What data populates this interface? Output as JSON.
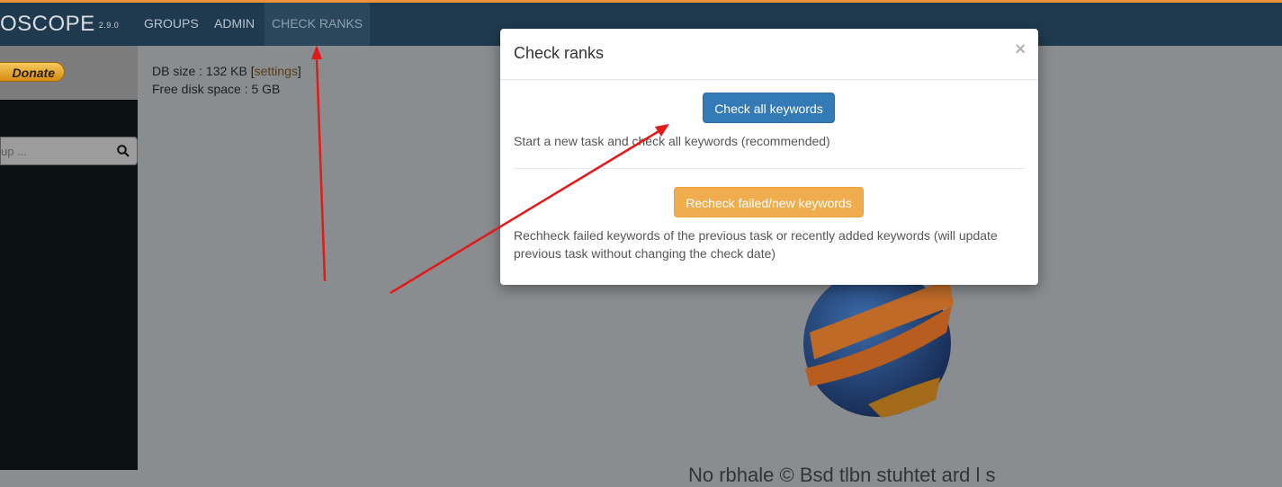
{
  "navbar": {
    "brand": "OSCOPE",
    "version": "2.9.0",
    "items": [
      "GROUPS",
      "ADMIN",
      "CHECK RANKS"
    ]
  },
  "sidebar": {
    "donate_label": "Donate",
    "search_placeholder": "up ..."
  },
  "info": {
    "db_size": "DB size : 132 KB [",
    "settings": "settings",
    "db_close": "]",
    "free_disk": "Free disk space : 5 GB"
  },
  "background": {
    "bottom_text": "No rbhale  © Bsd tlbn stuhtet ard l s"
  },
  "modal": {
    "title": "Check ranks",
    "close_symbol": "×",
    "check_all_label": "Check all keywords",
    "check_all_desc": "Start a new task and check all keywords (recommended)",
    "recheck_label": "Recheck failed/new keywords",
    "recheck_desc": "Rechheck failed keywords of the previous task or recently added keywords (will update previous task without changing the check date)"
  },
  "colors": {
    "navbar": "#1f3a4f",
    "primary": "#337ab7",
    "warning": "#f0ad4e",
    "arrow": "#e11a1a"
  }
}
